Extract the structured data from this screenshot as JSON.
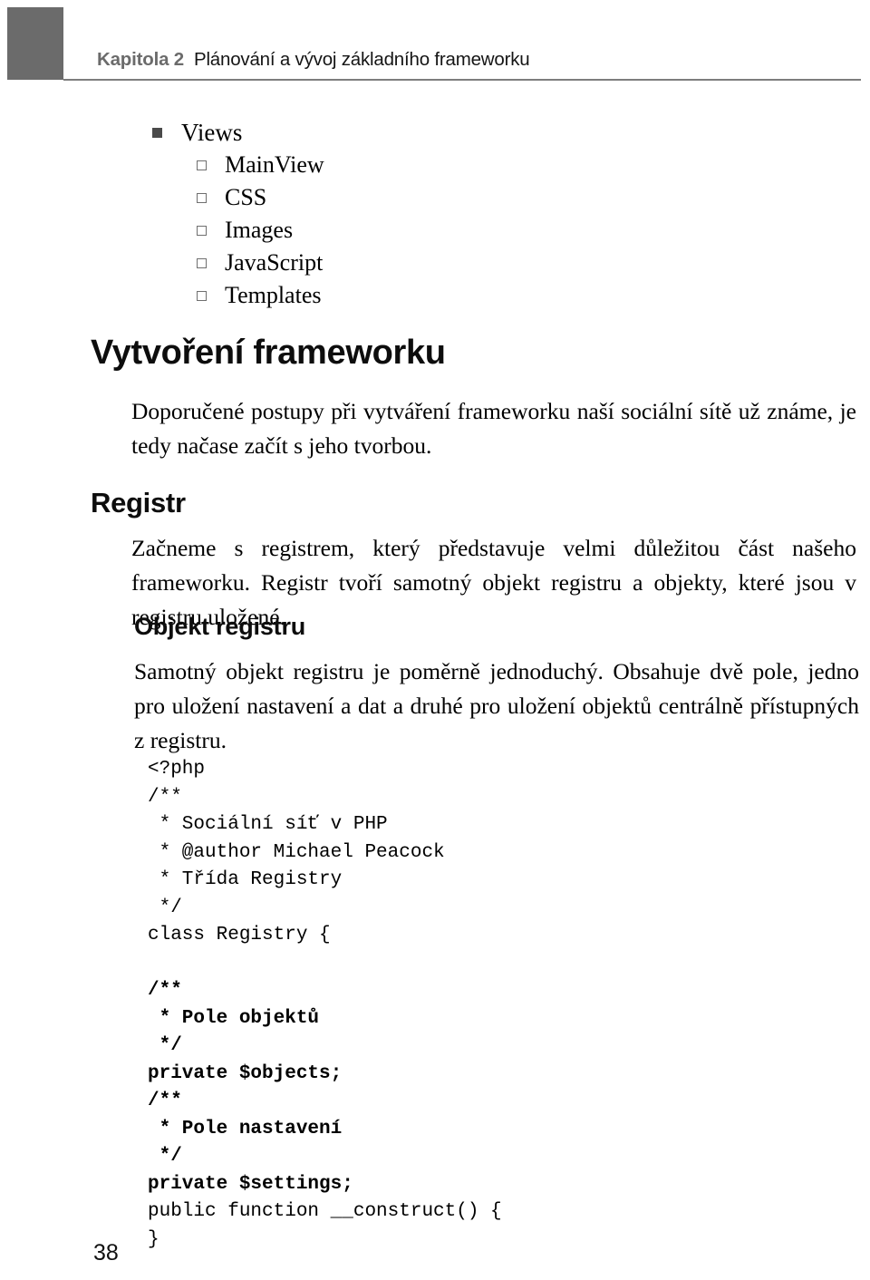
{
  "header": {
    "chapter_label": "Kapitola 2",
    "chapter_title": "Plánování a vývoj základního frameworku"
  },
  "outline": {
    "top_item": "Views",
    "sub_items": [
      "MainView",
      "CSS",
      "Images",
      "JavaScript",
      "Templates"
    ]
  },
  "sections": {
    "h1": "Vytvoření frameworku",
    "h1_body": "Doporučené postupy při vytváření frameworku naší sociální sítě už známe, je tedy načase začít s jeho tvorbou.",
    "h2": "Registr",
    "h2_body": "Začneme s registrem, který představuje velmi důležitou část našeho frameworku. Registr tvoří samotný objekt registru a objekty, které jsou v registru uložené.",
    "h3": "Objekt registru",
    "h3_body": "Samotný objekt registru je poměrně jednoduchý. Obsahuje dvě pole, jedno pro uložení nastavení a dat a druhé pro uložení objektů centrálně přístupných z registru."
  },
  "code": {
    "block_regular_1": "<?php\n/**\n * Sociální síť v PHP\n * @author Michael Peacock\n * Třída Registry\n */",
    "block_regular_2": "class Registry {",
    "block_bold_1": "/**\n * Pole objektů\n */\nprivate $objects;",
    "block_bold_2": "/**\n * Pole nastavení\n */\nprivate $settings;",
    "block_regular_3": "public function __construct() {\n}"
  },
  "folio": {
    "page_number": "38"
  },
  "colors": {
    "header_block": "#6b6b6b",
    "header_rule": "#7d7d7d",
    "bullet_filled": "#4a4a4a",
    "bullet_hollow_border": "#6f6f6f",
    "text": "#000000"
  }
}
